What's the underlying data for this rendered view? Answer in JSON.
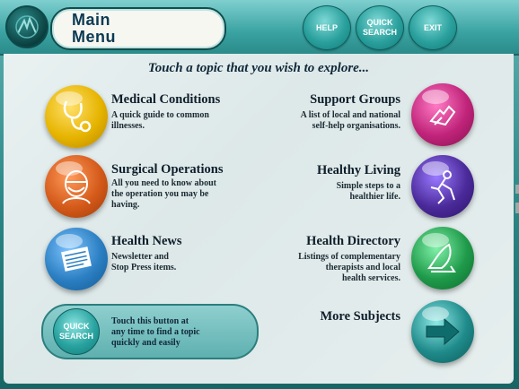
{
  "header": {
    "title_line1": "Main",
    "title_line2": "Menu",
    "help_label": "HELP",
    "quick_search_label_1": "QUICK",
    "quick_search_label_2": "SEARCH",
    "exit_label": "EXIT"
  },
  "prompt": "Touch a topic that you wish to explore...",
  "topics": {
    "medical": {
      "title": "Medical Conditions",
      "desc1": "A quick guide to common",
      "desc2": "illnesses."
    },
    "surgical": {
      "title": "Surgical Operations",
      "desc1": "All you need to know about",
      "desc2": "the operation you may be",
      "desc3": "having."
    },
    "news": {
      "title": "Health News",
      "desc1": "Newsletter and",
      "desc2": "Stop Press items."
    },
    "support": {
      "title": "Support Groups",
      "desc1": "A list of local and national",
      "desc2": "self-help organisations."
    },
    "living": {
      "title": "Healthy Living",
      "desc1": "Simple steps to a",
      "desc2": "healthier life."
    },
    "directory": {
      "title": "Health Directory",
      "desc1": "Listings of complementary",
      "desc2": "therapists and local",
      "desc3": "health services."
    },
    "more": {
      "title": "More Subjects"
    }
  },
  "quick_search_panel": {
    "button_line1": "QUICK",
    "button_line2": "SEARCH",
    "text1": "Touch this button at",
    "text2": "any time to find a topic",
    "text3": "quickly and easily"
  },
  "colors": {
    "teal": "#2aa09d",
    "medical": "#e6b400",
    "surgical": "#d45a1a",
    "news": "#2b7fc2",
    "support": "#c0247a",
    "living": "#4b2a9a",
    "directory": "#1f9a4a",
    "more": "#1f8a8a"
  }
}
